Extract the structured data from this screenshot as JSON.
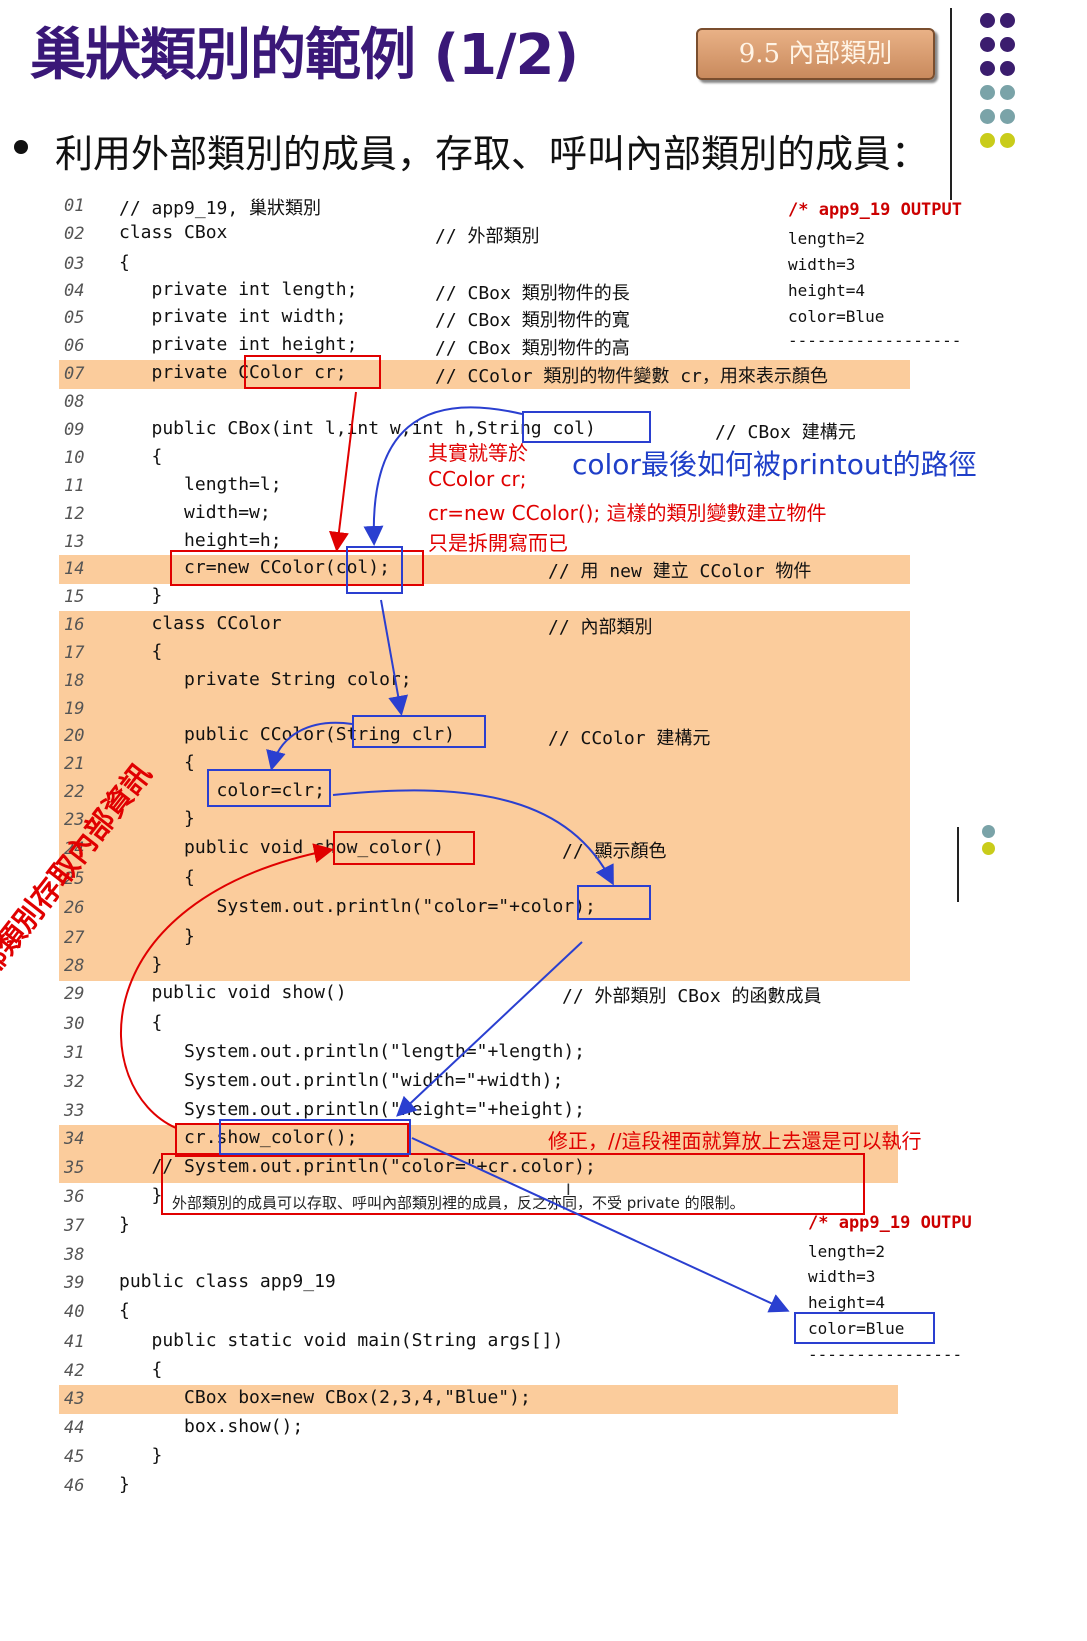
{
  "title": "巢狀類別的範例 (1/2)",
  "section_badge": "9.5 內部類別",
  "subtitle": "利用外部類別的成員，存取、呼叫內部類別的成員：",
  "code_lines": [
    {
      "n": "01",
      "code": "// app9_19, 巢狀類別",
      "comment": ""
    },
    {
      "n": "02",
      "code": "class CBox",
      "comment": "// 外部類別"
    },
    {
      "n": "03",
      "code": "{",
      "comment": ""
    },
    {
      "n": "04",
      "code": "   private int length;",
      "comment": "// CBox 類別物件的長"
    },
    {
      "n": "05",
      "code": "   private int width;",
      "comment": "// CBox 類別物件的寬"
    },
    {
      "n": "06",
      "code": "   private int height;",
      "comment": "// CBox 類別物件的高"
    },
    {
      "n": "07",
      "code": "   private CColor cr;",
      "comment": "// CColor 類別的物件變數 cr，用來表示顏色"
    },
    {
      "n": "08",
      "code": "",
      "comment": ""
    },
    {
      "n": "09",
      "code": "   public CBox(int l,int w,int h,String col)",
      "comment": "// CBox 建構元"
    },
    {
      "n": "10",
      "code": "   {",
      "comment": ""
    },
    {
      "n": "11",
      "code": "      length=l;",
      "comment": ""
    },
    {
      "n": "12",
      "code": "      width=w;",
      "comment": ""
    },
    {
      "n": "13",
      "code": "      height=h;",
      "comment": ""
    },
    {
      "n": "14",
      "code": "      cr=new CColor(col);",
      "comment": "// 用 new 建立 CColor 物件"
    },
    {
      "n": "15",
      "code": "   }",
      "comment": ""
    },
    {
      "n": "16",
      "code": "   class CColor",
      "comment": "// 內部類別"
    },
    {
      "n": "17",
      "code": "   {",
      "comment": ""
    },
    {
      "n": "18",
      "code": "      private String color;",
      "comment": ""
    },
    {
      "n": "19",
      "code": "",
      "comment": ""
    },
    {
      "n": "20",
      "code": "      public CColor(String clr)",
      "comment": "// CColor 建構元"
    },
    {
      "n": "21",
      "code": "      {",
      "comment": ""
    },
    {
      "n": "22",
      "code": "         color=clr;",
      "comment": ""
    },
    {
      "n": "23",
      "code": "      }",
      "comment": ""
    },
    {
      "n": "24",
      "code": "      public void show_color()",
      "comment": "// 顯示顏色"
    },
    {
      "n": "25",
      "code": "      {",
      "comment": ""
    },
    {
      "n": "26",
      "code": "         System.out.println(\"color=\"+color);",
      "comment": ""
    },
    {
      "n": "27",
      "code": "      }",
      "comment": ""
    },
    {
      "n": "28",
      "code": "   }",
      "comment": ""
    },
    {
      "n": "29",
      "code": "   public void show()",
      "comment": "// 外部類別 CBox 的函數成員"
    },
    {
      "n": "30",
      "code": "   {",
      "comment": ""
    },
    {
      "n": "31",
      "code": "      System.out.println(\"length=\"+length);",
      "comment": ""
    },
    {
      "n": "32",
      "code": "      System.out.println(\"width=\"+width);",
      "comment": ""
    },
    {
      "n": "33",
      "code": "      System.out.println(\"height=\"+height);",
      "comment": ""
    },
    {
      "n": "34",
      "code": "      cr.show_color();",
      "comment": ""
    },
    {
      "n": "35",
      "code": "   // System.out.println(\"color=\"+cr.color);",
      "comment": ""
    },
    {
      "n": "36",
      "code": "   }",
      "comment": ""
    },
    {
      "n": "37",
      "code": "}",
      "comment": ""
    },
    {
      "n": "38",
      "code": "",
      "comment": ""
    },
    {
      "n": "39",
      "code": "public class app9_19",
      "comment": ""
    },
    {
      "n": "40",
      "code": "{",
      "comment": ""
    },
    {
      "n": "41",
      "code": "   public static void main(String args[])",
      "comment": ""
    },
    {
      "n": "42",
      "code": "   {",
      "comment": ""
    },
    {
      "n": "43",
      "code": "      CBox box=new CBox(2,3,4,\"Blue\");",
      "comment": ""
    },
    {
      "n": "44",
      "code": "      box.show();",
      "comment": ""
    },
    {
      "n": "45",
      "code": "   }",
      "comment": ""
    },
    {
      "n": "46",
      "code": "}",
      "comment": ""
    }
  ],
  "output_top": {
    "header": "/* app9_19 OUTPUT",
    "lines": [
      "length=2",
      "width=3",
      "height=4",
      "color=Blue"
    ],
    "rule": "------------------"
  },
  "output_bottom": {
    "header": "/* app9_19 OUTPU",
    "lines": [
      "length=2",
      "width=3",
      "height=4",
      "color=Blue"
    ],
    "rule": "----------------"
  },
  "annotations": {
    "equivalent": [
      "其實就等於",
      "CColor cr;",
      "cr=new CColor(); 這樣的類別變數建立物件",
      "只是拆開寫而已"
    ],
    "path_label": "color最後如何被printout的路徑",
    "outer_access": "外部類別存取內部資訊",
    "fix_note": "修正，//這段裡面就算放上去還是可以執行",
    "rule_note": "外部類別的成員可以存取、呼叫內部類別裡的成員，反之亦同，不受 private 的限制。"
  },
  "colors": {
    "title": "#3a1878",
    "highlight": "#fbcc9c",
    "red": "#e00000",
    "blue": "#2a3fd0",
    "dots": [
      "#3b1d6e",
      "#3b1d6e",
      "#3b1d6e",
      "#7aa3a8",
      "#7aa3a8",
      "#c9cc1a"
    ]
  }
}
